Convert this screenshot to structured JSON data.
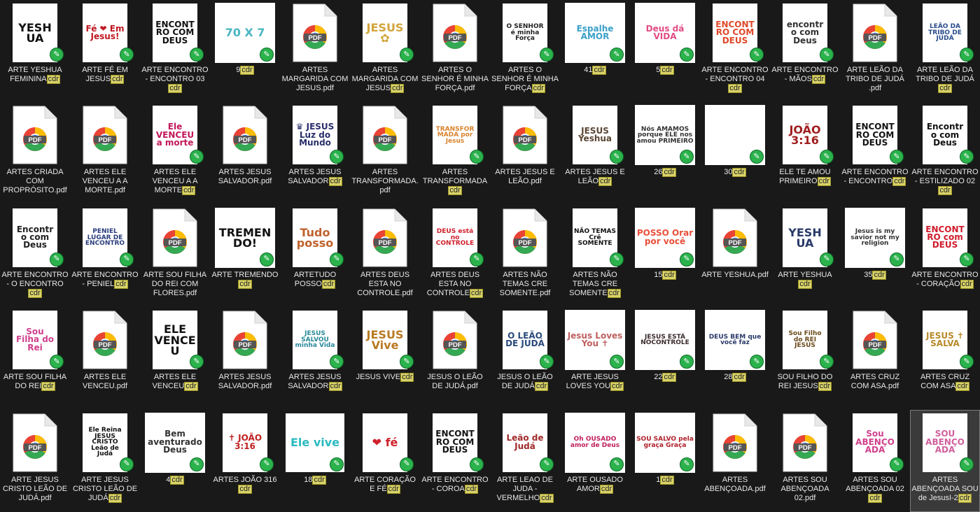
{
  "files": [
    {
      "name": "ARTE YESHUA FEMININA",
      "ext": "cdr",
      "kind": "cdr",
      "art": "YESHUA",
      "icon": "artwork-thumbnail",
      "bg": "#ffffff",
      "fg": "#111111",
      "shape": "tall"
    },
    {
      "name": "ARTE FÉ EM JESUS",
      "ext": "cdr",
      "kind": "cdr",
      "art": "Fé ❤ Em Jesus!",
      "icon": "artwork-thumbnail",
      "bg": "#ffffff",
      "fg": "#c01822",
      "shape": "tall"
    },
    {
      "name": "ARTE ENCONTRO - ENCONTRO 03",
      "ext": "cdr",
      "kind": "cdr",
      "art": "ENCONTRO COM DEUS",
      "icon": "artwork-thumbnail",
      "bg": "#ffffff",
      "fg": "#111111",
      "shape": "tall"
    },
    {
      "name": "9",
      "ext": "cdr",
      "kind": "cdr",
      "art": "70 X 7",
      "icon": "artwork-thumbnail",
      "bg": "#ffffff",
      "fg": "#4bb6c2",
      "shape": "sq"
    },
    {
      "name": "ARTES MARGARIDA COM JESUS.pdf",
      "ext": "",
      "kind": "pdf",
      "art": "",
      "icon": "pdf-file-icon",
      "bg": "",
      "fg": "",
      "shape": "doc"
    },
    {
      "name": "ARTES MARGARIDA COM JESUS",
      "ext": "cdr",
      "kind": "cdr",
      "art": "JESUS ✿",
      "icon": "artwork-thumbnail",
      "bg": "#ffffff",
      "fg": "#d1a53a",
      "shape": "tall"
    },
    {
      "name": "ARTES O SENHOR É MINHA FORÇA.pdf",
      "ext": "",
      "kind": "pdf",
      "art": "",
      "icon": "pdf-file-icon",
      "bg": "",
      "fg": "",
      "shape": "doc"
    },
    {
      "name": "ARTES O SENHOR É MINHA FORÇA",
      "ext": "cdr",
      "kind": "cdr",
      "art": "O SENHOR é minha Força",
      "icon": "artwork-thumbnail",
      "bg": "#ffffff",
      "fg": "#222222",
      "shape": "tall"
    },
    {
      "name": "41",
      "ext": "cdr",
      "kind": "cdr",
      "art": "Espalhe AMOR",
      "icon": "artwork-thumbnail",
      "bg": "#ffffff",
      "fg": "#3aa0c8",
      "shape": "sq"
    },
    {
      "name": "5",
      "ext": "cdr",
      "kind": "cdr",
      "art": "Deus dá VIDA",
      "icon": "artwork-thumbnail",
      "bg": "#ffffff",
      "fg": "#e24c84",
      "shape": "sq"
    },
    {
      "name": "ARTE ENCONTRO - ENCONTRO 04",
      "ext": "cdr",
      "kind": "cdr",
      "art": "ENCONTRO COM DEUS",
      "icon": "artwork-thumbnail",
      "bg": "#ffffff",
      "fg": "#e0492a",
      "shape": "tall"
    },
    {
      "name": "ARTE ENCONTRO - MÃOS",
      "ext": "cdr",
      "kind": "cdr",
      "art": "encontro com Deus",
      "icon": "artwork-thumbnail",
      "bg": "#ffffff",
      "fg": "#333333",
      "shape": "tall"
    },
    {
      "name": "ARTE LEÃO DA TRIBO DE JUDÁ .pdf",
      "ext": "",
      "kind": "pdf",
      "art": "",
      "icon": "pdf-file-icon",
      "bg": "",
      "fg": "",
      "shape": "doc"
    },
    {
      "name": "ARTE LEÃO DA TRIBO DE JUDÁ",
      "ext": "cdr",
      "kind": "cdr",
      "art": "LEÃO DA TRIBO DE JUDÁ",
      "icon": "artwork-thumbnail",
      "bg": "#ffffff",
      "fg": "#2a4c8c",
      "shape": "tall"
    },
    {
      "name": "ARTES CRIADA COM PROPRÓSITO.pdf",
      "ext": "",
      "kind": "pdf",
      "art": "",
      "icon": "pdf-file-icon",
      "bg": "",
      "fg": "",
      "shape": "doc"
    },
    {
      "name": "ARTES ELE VENCEU A A MORTE.pdf",
      "ext": "",
      "kind": "pdf",
      "art": "",
      "icon": "pdf-file-icon",
      "bg": "",
      "fg": "",
      "shape": "doc"
    },
    {
      "name": "ARTES ELE VENCEU A A MORTE",
      "ext": "cdr",
      "kind": "cdr",
      "art": "Ele VENCEU a morte",
      "icon": "artwork-thumbnail",
      "bg": "#ffffff",
      "fg": "#c2185b",
      "shape": "tall"
    },
    {
      "name": "ARTES JESUS SALVADOR.pdf",
      "ext": "",
      "kind": "pdf",
      "art": "",
      "icon": "pdf-file-icon",
      "bg": "",
      "fg": "",
      "shape": "doc"
    },
    {
      "name": "ARTES JESUS SALVADOR",
      "ext": "cdr",
      "kind": "cdr",
      "art": "♛ JESUS Luz do Mundo",
      "icon": "artwork-thumbnail",
      "bg": "#ffffff",
      "fg": "#2a2f6b",
      "shape": "tall"
    },
    {
      "name": "ARTES TRANSFORMADA.pdf",
      "ext": "",
      "kind": "pdf",
      "art": "",
      "icon": "pdf-file-icon",
      "bg": "",
      "fg": "",
      "shape": "doc"
    },
    {
      "name": "ARTES TRANSFORMADA",
      "ext": "cdr",
      "kind": "cdr",
      "art": "TRANSFORMADA por Jesus",
      "icon": "artwork-thumbnail",
      "bg": "#ffffff",
      "fg": "#d9822b",
      "shape": "tall"
    },
    {
      "name": "ARTES JESUS E LEÃO.pdf",
      "ext": "",
      "kind": "pdf",
      "art": "",
      "icon": "pdf-file-icon",
      "bg": "",
      "fg": "",
      "shape": "doc"
    },
    {
      "name": "ARTES JESUS E LEÃO",
      "ext": "cdr",
      "kind": "cdr",
      "art": "JESUS Yeshua",
      "icon": "artwork-thumbnail",
      "bg": "#ffffff",
      "fg": "#5a4634",
      "shape": "tall"
    },
    {
      "name": "26",
      "ext": "cdr",
      "kind": "cdr",
      "art": "Nós AMAMOS porque ELE nos amou PRIMEIRO",
      "icon": "artwork-thumbnail",
      "bg": "#ffffff",
      "fg": "#333333",
      "shape": "sq"
    },
    {
      "name": "30",
      "ext": "cdr",
      "kind": "cdr",
      "art": "",
      "icon": "artwork-thumbnail",
      "bg": "#ffffff",
      "fg": "#333333",
      "shape": "sq"
    },
    {
      "name": "ELE TE AMOU PRIMEIRO",
      "ext": "cdr",
      "kind": "cdr",
      "art": "JOÃO 3:16",
      "icon": "artwork-thumbnail",
      "bg": "#ffffff",
      "fg": "#a02020",
      "shape": "tall"
    },
    {
      "name": "ARTE ENCONTRO - ENCONTRO",
      "ext": "cdr",
      "kind": "cdr",
      "art": "ENCONTRO COM DEUS",
      "icon": "artwork-thumbnail",
      "bg": "#ffffff",
      "fg": "#111111",
      "shape": "tall"
    },
    {
      "name": "ARTE ENCONTRO - ESTILIZADO 02",
      "ext": "cdr",
      "kind": "cdr",
      "art": "Encontro com Deus",
      "icon": "artwork-thumbnail",
      "bg": "#ffffff",
      "fg": "#111111",
      "shape": "tall"
    },
    {
      "name": "ARTE ENCONTRO - O ENCONTRO",
      "ext": "cdr",
      "kind": "cdr",
      "art": "Encontro com Deus",
      "icon": "artwork-thumbnail",
      "bg": "#ffffff",
      "fg": "#222222",
      "shape": "tall"
    },
    {
      "name": "ARTE ENCONTRO - PENIEL",
      "ext": "cdr",
      "kind": "cdr",
      "art": "PENIEL LUGAR DE ENCONTRO",
      "icon": "artwork-thumbnail",
      "bg": "#ffffff",
      "fg": "#2a3c7c",
      "shape": "tall"
    },
    {
      "name": "ARTE SOU FILHA DO REI COM FLORES.pdf",
      "ext": "",
      "kind": "pdf",
      "art": "",
      "icon": "pdf-file-icon",
      "bg": "",
      "fg": "",
      "shape": "doc"
    },
    {
      "name": "ARTE TREMENDO",
      "ext": "cdr",
      "kind": "cdr",
      "art": "TREMEN DO!",
      "icon": "artwork-thumbnail",
      "bg": "#ffffff",
      "fg": "#111111",
      "shape": "sq"
    },
    {
      "name": "ARTETUDO POSSO",
      "ext": "cdr",
      "kind": "cdr",
      "art": "Tudo posso",
      "icon": "artwork-thumbnail",
      "bg": "#ffffff",
      "fg": "#c0622c",
      "shape": "tall"
    },
    {
      "name": "ARTES DEUS ESTA NO CONTROLE.pdf",
      "ext": "",
      "kind": "pdf",
      "art": "",
      "icon": "pdf-file-icon",
      "bg": "",
      "fg": "",
      "shape": "doc"
    },
    {
      "name": "ARTES DEUS ESTA NO CONTROLE",
      "ext": "cdr",
      "kind": "cdr",
      "art": "DEUS está no CONTROLE",
      "icon": "artwork-thumbnail",
      "bg": "#ffffff",
      "fg": "#d0202c",
      "shape": "tall"
    },
    {
      "name": "ARTES NÃO TEMAS CRE SOMENTE.pdf",
      "ext": "",
      "kind": "pdf",
      "art": "",
      "icon": "pdf-file-icon",
      "bg": "",
      "fg": "",
      "shape": "doc"
    },
    {
      "name": "ARTES NÃO TEMAS CRE SOMENTE",
      "ext": "cdr",
      "kind": "cdr",
      "art": "NÃO TEMAS Crê SOMENTE",
      "icon": "artwork-thumbnail",
      "bg": "#ffffff",
      "fg": "#111111",
      "shape": "tall"
    },
    {
      "name": "15",
      "ext": "cdr",
      "kind": "cdr",
      "art": "POSSO Orar por você",
      "icon": "artwork-thumbnail",
      "bg": "#ffffff",
      "fg": "#e8503a",
      "shape": "sq"
    },
    {
      "name": "ARTE YESHUA.pdf",
      "ext": "",
      "kind": "pdf",
      "art": "",
      "icon": "pdf-file-icon",
      "bg": "",
      "fg": "",
      "shape": "doc"
    },
    {
      "name": "ARTE YESHUA",
      "ext": "cdr",
      "kind": "cdr",
      "art": "YESHUA",
      "icon": "artwork-thumbnail",
      "bg": "#ffffff",
      "fg": "#2a3a6a",
      "shape": "tall"
    },
    {
      "name": "35",
      "ext": "cdr",
      "kind": "cdr",
      "art": "Jesus is my savior not my religion",
      "icon": "artwork-thumbnail",
      "bg": "#ffffff",
      "fg": "#333333",
      "shape": "sq"
    },
    {
      "name": "ARTE ENCONTRO - CORAÇÃO",
      "ext": "cdr",
      "kind": "cdr",
      "art": "ENCONTRO com DEUS",
      "icon": "artwork-thumbnail",
      "bg": "#ffffff",
      "fg": "#d01c2c",
      "shape": "tall"
    },
    {
      "name": "ARTE SOU FILHA DO REI",
      "ext": "cdr",
      "kind": "cdr",
      "art": "Sou Filha do Rei",
      "icon": "artwork-thumbnail",
      "bg": "#ffffff",
      "fg": "#d0408c",
      "shape": "tall"
    },
    {
      "name": "ARTES ELE VENCEU.pdf",
      "ext": "",
      "kind": "pdf",
      "art": "",
      "icon": "pdf-file-icon",
      "bg": "",
      "fg": "",
      "shape": "doc"
    },
    {
      "name": "ARTES ELE VENCEU",
      "ext": "cdr",
      "kind": "cdr",
      "art": "ELE VENCEU",
      "icon": "artwork-thumbnail",
      "bg": "#ffffff",
      "fg": "#111111",
      "shape": "tall"
    },
    {
      "name": "ARTES JESUS SALVADOR.pdf",
      "ext": "",
      "kind": "pdf",
      "art": "",
      "icon": "pdf-file-icon",
      "bg": "",
      "fg": "",
      "shape": "doc"
    },
    {
      "name": "ARTES JESUS SALVADOR",
      "ext": "cdr",
      "kind": "cdr",
      "art": "JESUS SALVOU minha Vida",
      "icon": "artwork-thumbnail",
      "bg": "#ffffff",
      "fg": "#2a8a9a",
      "shape": "tall"
    },
    {
      "name": "JESUS VIVE",
      "ext": "cdr",
      "kind": "cdr",
      "art": "JESUS Vive",
      "icon": "artwork-thumbnail",
      "bg": "#ffffff",
      "fg": "#b87a22",
      "shape": "tall"
    },
    {
      "name": "JESUS O LEÃO DE JUDÁ.pdf",
      "ext": "",
      "kind": "pdf",
      "art": "",
      "icon": "pdf-file-icon",
      "bg": "",
      "fg": "",
      "shape": "doc"
    },
    {
      "name": "JESUS O LEÃO DE JUDÁ",
      "ext": "cdr",
      "kind": "cdr",
      "art": "O LEÃO DE JUDÁ",
      "icon": "artwork-thumbnail",
      "bg": "#ffffff",
      "fg": "#2a4a7a",
      "shape": "tall"
    },
    {
      "name": "ARTE JESUS LOVES YOU",
      "ext": "cdr",
      "kind": "cdr",
      "art": "Jesus Loves You ✝",
      "icon": "artwork-thumbnail",
      "bg": "#ffffff",
      "fg": "#c06060",
      "shape": "sq"
    },
    {
      "name": "22",
      "ext": "cdr",
      "kind": "cdr",
      "art": "JESUS ESTÁ NOCONTROLE",
      "icon": "artwork-thumbnail",
      "bg": "#ffffff",
      "fg": "#3a2a2a",
      "shape": "sq"
    },
    {
      "name": "28",
      "ext": "cdr",
      "kind": "cdr",
      "art": "DEUS BEM que você faz",
      "icon": "artwork-thumbnail",
      "bg": "#ffffff",
      "fg": "#2a3a6a",
      "shape": "sq"
    },
    {
      "name": "SOU FILHO DO REI JESUS",
      "ext": "cdr",
      "kind": "cdr",
      "art": "Sou Filho do REI JESUS",
      "icon": "artwork-thumbnail",
      "bg": "#ffffff",
      "fg": "#6a4a1a",
      "shape": "tall"
    },
    {
      "name": "ARTES CRUZ COM ASA.pdf",
      "ext": "",
      "kind": "pdf",
      "art": "",
      "icon": "pdf-file-icon",
      "bg": "",
      "fg": "",
      "shape": "doc"
    },
    {
      "name": "ARTES CRUZ COM ASA",
      "ext": "cdr",
      "kind": "cdr",
      "art": "JESUS ✝ SALVA",
      "icon": "artwork-thumbnail",
      "bg": "#ffffff",
      "fg": "#b88a2a",
      "shape": "tall"
    },
    {
      "name": "ARTE JESUS CRISTO LEÃO DE JUDÁ.pdf",
      "ext": "",
      "kind": "pdf",
      "art": "",
      "icon": "pdf-file-icon",
      "bg": "",
      "fg": "",
      "shape": "doc"
    },
    {
      "name": "ARTE JESUS CRISTO LEÃO DE JUDÁ",
      "ext": "cdr",
      "kind": "cdr",
      "art": "Ele Reina JESUS CRISTO Leão de Judá",
      "icon": "artwork-thumbnail",
      "bg": "#ffffff",
      "fg": "#111111",
      "shape": "tall"
    },
    {
      "name": "4",
      "ext": "cdr",
      "kind": "cdr",
      "art": "Bem aventurado Deus",
      "icon": "artwork-thumbnail",
      "bg": "#ffffff",
      "fg": "#333333",
      "shape": "sq"
    },
    {
      "name": "ARTES JOÃO 316",
      "ext": "cdr",
      "kind": "cdr",
      "art": "✝ JOÃO 3:16",
      "icon": "artwork-thumbnail",
      "bg": "#ffffff",
      "fg": "#c02020",
      "shape": "tall"
    },
    {
      "name": "18",
      "ext": "cdr",
      "kind": "cdr",
      "art": "Ele vive",
      "icon": "artwork-thumbnail",
      "bg": "#ffffff",
      "fg": "#2abac0",
      "shape": "wide"
    },
    {
      "name": "ARTE CORAÇÃO E FÉ",
      "ext": "cdr",
      "kind": "cdr",
      "art": "❤ fé",
      "icon": "artwork-thumbnail",
      "bg": "#ffffff",
      "fg": "#d0202c",
      "shape": "tall"
    },
    {
      "name": "ARTE ENCONTRO - COROA",
      "ext": "cdr",
      "kind": "cdr",
      "art": "ENCONTRO COM DEUS",
      "icon": "artwork-thumbnail",
      "bg": "#ffffff",
      "fg": "#111111",
      "shape": "tall"
    },
    {
      "name": "ARTE LEAO DE JUDA - VERMELHO",
      "ext": "cdr",
      "kind": "cdr",
      "art": "Leão de Judá",
      "icon": "artwork-thumbnail",
      "bg": "#ffffff",
      "fg": "#a02a2a",
      "shape": "tall"
    },
    {
      "name": "ARTE OUSADO AMOR",
      "ext": "cdr",
      "kind": "cdr",
      "art": "Oh OUSADO amor de Deus",
      "icon": "artwork-thumbnail",
      "bg": "#ffffff",
      "fg": "#c0205c",
      "shape": "sq"
    },
    {
      "name": "1",
      "ext": "cdr",
      "kind": "cdr",
      "art": "SOU SALVO pela graça Graça",
      "icon": "artwork-thumbnail",
      "bg": "#ffffff",
      "fg": "#b0202a",
      "shape": "sq"
    },
    {
      "name": "ARTES ABENÇOADA.pdf",
      "ext": "",
      "kind": "pdf",
      "art": "",
      "icon": "pdf-file-icon",
      "bg": "",
      "fg": "",
      "shape": "doc"
    },
    {
      "name": "ARTES SOU ABENÇOADA 02.pdf",
      "ext": "",
      "kind": "pdf",
      "art": "",
      "icon": "pdf-file-icon",
      "bg": "",
      "fg": "",
      "shape": "doc"
    },
    {
      "name": "ARTES SOU ABENÇOADA 02",
      "ext": "cdr",
      "kind": "cdr",
      "art": "Sou ABENÇOADA",
      "icon": "artwork-thumbnail",
      "bg": "#ffffff",
      "fg": "#d0408c",
      "shape": "tall"
    },
    {
      "name": "ARTES ABENÇOADA SOU de JesusI-2",
      "ext": "cdr",
      "kind": "cdr",
      "art": "SOU ABENÇOADA",
      "icon": "artwork-thumbnail",
      "bg": "#ffffff",
      "fg": "#d0609c",
      "shape": "tall",
      "selected": true
    }
  ],
  "colors": {
    "background": "#191919",
    "sync_badge": "#2bb24c",
    "ext_highlight": "#d9d36a",
    "pdf_red": "#e94335",
    "pdf_yellow": "#fbbc04",
    "pdf_green": "#34a853",
    "pdf_blue": "#4285f4"
  },
  "pdf_label": "PDF",
  "badge_glyph": "✎"
}
